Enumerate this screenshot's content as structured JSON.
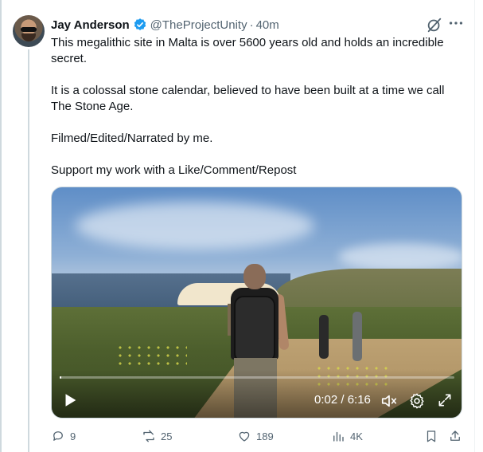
{
  "post": {
    "author_name": "Jay Anderson",
    "handle": "@TheProjectUnity",
    "separator": "·",
    "time": "40m",
    "paragraphs": [
      "This megalithic site in Malta is over 5600 years old and holds an incredible secret.",
      "It is a colossal stone calendar, believed to have been built at a time we call The Stone Age.",
      "Filmed/Edited/Narrated by me.",
      "Support my work with a Like/Comment/Repost"
    ]
  },
  "video": {
    "time_display": "0:02 / 6:16",
    "progress_fraction": 0.005
  },
  "actions": {
    "replies": "9",
    "reposts": "25",
    "likes": "189",
    "views": "4K"
  },
  "colors": {
    "verified": "#1d9bf0",
    "secondary_text": "#536471",
    "primary_text": "#0f1419"
  },
  "icons": [
    "grok-icon",
    "more-icon",
    "play-icon",
    "volume-icon",
    "settings-icon",
    "fullscreen-icon",
    "reply-icon",
    "repost-icon",
    "like-icon",
    "views-icon",
    "bookmark-icon",
    "share-icon"
  ]
}
